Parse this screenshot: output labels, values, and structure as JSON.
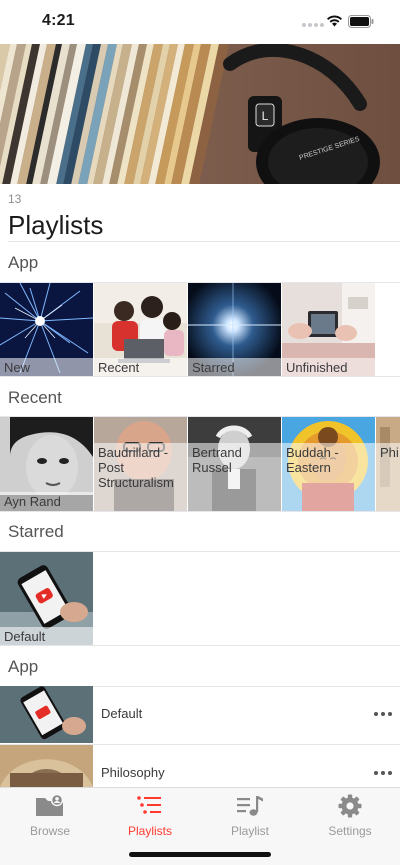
{
  "status": {
    "time": "4:21"
  },
  "header": {
    "count": "13",
    "title": "Playlists"
  },
  "sections": {
    "app_tiles": {
      "title": "App",
      "tiles": [
        {
          "label": "New"
        },
        {
          "label": "Recent"
        },
        {
          "label": "Starred"
        },
        {
          "label": "Unfinished"
        }
      ]
    },
    "recent": {
      "title": "Recent",
      "tiles": [
        {
          "label": "Ayn Rand"
        },
        {
          "label": "Baudrillard - Post Structuralism"
        },
        {
          "label": "Bertrand Russel"
        },
        {
          "label": "Buddah - Eastern"
        },
        {
          "label": "Phi"
        }
      ]
    },
    "starred": {
      "title": "Starred",
      "tiles": [
        {
          "label": "Default"
        }
      ]
    },
    "app_list": {
      "title": "App",
      "items": [
        {
          "label": "Default"
        },
        {
          "label": "Philosophy"
        }
      ]
    }
  },
  "tabbar": {
    "accent": "#ff3b30",
    "inactive": "#9a9a9a",
    "tabs": [
      {
        "label": "Browse",
        "icon": "folder-user-icon"
      },
      {
        "label": "Playlists",
        "icon": "list-icon"
      },
      {
        "label": "Playlist",
        "icon": "music-list-icon"
      },
      {
        "label": "Settings",
        "icon": "gear-icon"
      }
    ],
    "active": "Playlists"
  }
}
